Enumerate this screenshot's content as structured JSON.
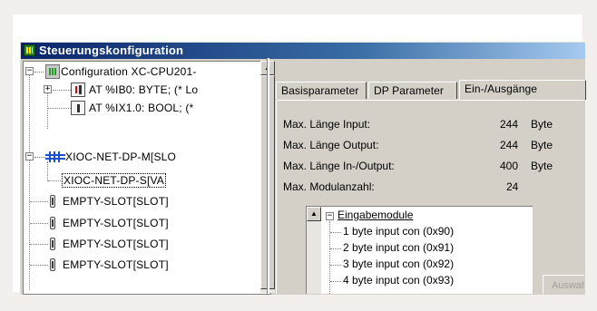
{
  "window": {
    "title": "Steuerungskonfiguration"
  },
  "tree": {
    "root": "Configuration XC-CPU201-",
    "items": [
      "AT %IB0: BYTE; (* Lo",
      "AT %IX1.0: BOOL; (*",
      "XIOC-NET-DP-M[SLO",
      "XIOC-NET-DP-S[VA",
      "EMPTY-SLOT[SLOT]",
      "EMPTY-SLOT[SLOT]",
      "EMPTY-SLOT[SLOT]",
      "EMPTY-SLOT[SLOT]"
    ],
    "expander_plus": "+",
    "expander_minus": "−"
  },
  "scroll": {
    "up": "▲"
  },
  "tabs": [
    "Basisparameter",
    "DP Parameter",
    "Ein-/Ausgänge"
  ],
  "info": {
    "rows": [
      {
        "label": "Max. Länge Input:",
        "value": "244",
        "unit": "Byte"
      },
      {
        "label": "Max. Länge Output:",
        "value": "244",
        "unit": "Byte"
      },
      {
        "label": "Max. Länge In-/Output:",
        "value": "400",
        "unit": "Byte"
      },
      {
        "label": "Max. Modulanzahl:",
        "value": "24",
        "unit": ""
      }
    ]
  },
  "modules": {
    "group": "Eingabemodule",
    "items": [
      "1 byte input con  (0x90)",
      "2 byte input con  (0x91)",
      "3 byte input con  (0x92)",
      "4 byte input con  (0x93)"
    ]
  },
  "buttons": {
    "select": "Auswahl"
  }
}
